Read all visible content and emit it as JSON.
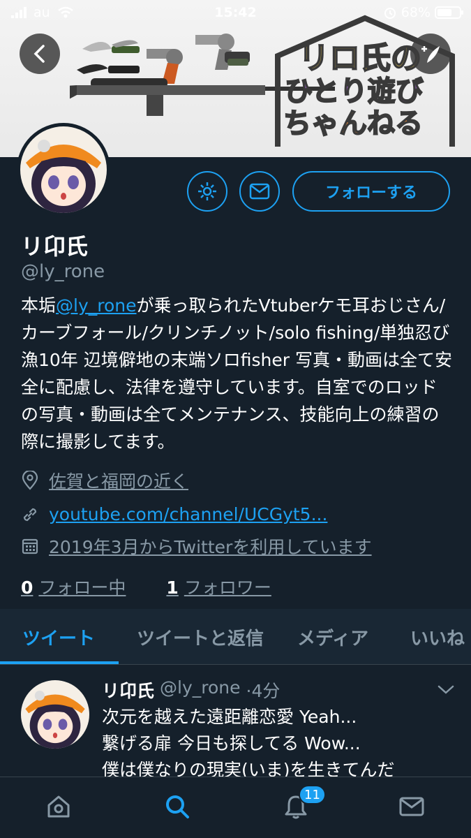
{
  "status_bar": {
    "carrier": "au",
    "time": "15:42",
    "battery_percent": "68%",
    "battery_level": 0.68
  },
  "banner": {
    "logo_lines": [
      "リロ氏の",
      "ひとり遊び",
      "ちゃんねる"
    ],
    "colors": {
      "logo_outline": "#3a3a3a",
      "logo_yellow": "#e7c64a",
      "logo_purple": "#8a5aa8",
      "logo_orange": "#e58a3a",
      "logo_green": "#6a9a4a"
    }
  },
  "profile": {
    "name": "リ卬氏",
    "handle": "@ly_rone",
    "bio_prefix": "本垢",
    "bio_mention": "@ly_rone",
    "bio_rest": "が乗っ取られたVtuberケモ耳おじさん/カーブフォール/クリンチノット/solo fishing/単独忍び漁10年 辺境僻地の末端ソロfisher 写真・動画は全て安全に配慮し、法律を遵守しています。自室でのロッドの写真・動画は全てメンテナンス、技能向上の練習の際に撮影してます。",
    "location": "佐賀と福岡の近く",
    "url": "youtube.com/channel/UCGyt5...",
    "joined": "2019年3月からTwitterを利用しています",
    "following_count": "0",
    "following_label": "フォロー中",
    "followers_count": "1",
    "followers_label": "フォロワー",
    "follow_button": "フォローする"
  },
  "tabs": [
    {
      "label": "ツイート",
      "active": true
    },
    {
      "label": "ツイートと返信",
      "active": false
    },
    {
      "label": "メディア",
      "active": false
    },
    {
      "label": "いいね",
      "active": false
    }
  ],
  "tweet": {
    "name": "リ卬氏",
    "handle": "@ly_rone",
    "time": "·4分",
    "lines": [
      "次元を越えた遠距離恋愛 Yeah...",
      "繋げる扉 今日も探してる Wow...",
      "僕は僕なりの現実(いま)を生きてんだ"
    ]
  },
  "bottom_nav": {
    "items": [
      "home-icon",
      "search-icon",
      "notifications-icon",
      "messages-icon"
    ],
    "active": "search-icon",
    "notification_badge": "11"
  },
  "colors": {
    "background": "#15202b",
    "accent": "#1da1f2",
    "secondary_text": "#8899a6",
    "tab_bar": "#192734"
  }
}
